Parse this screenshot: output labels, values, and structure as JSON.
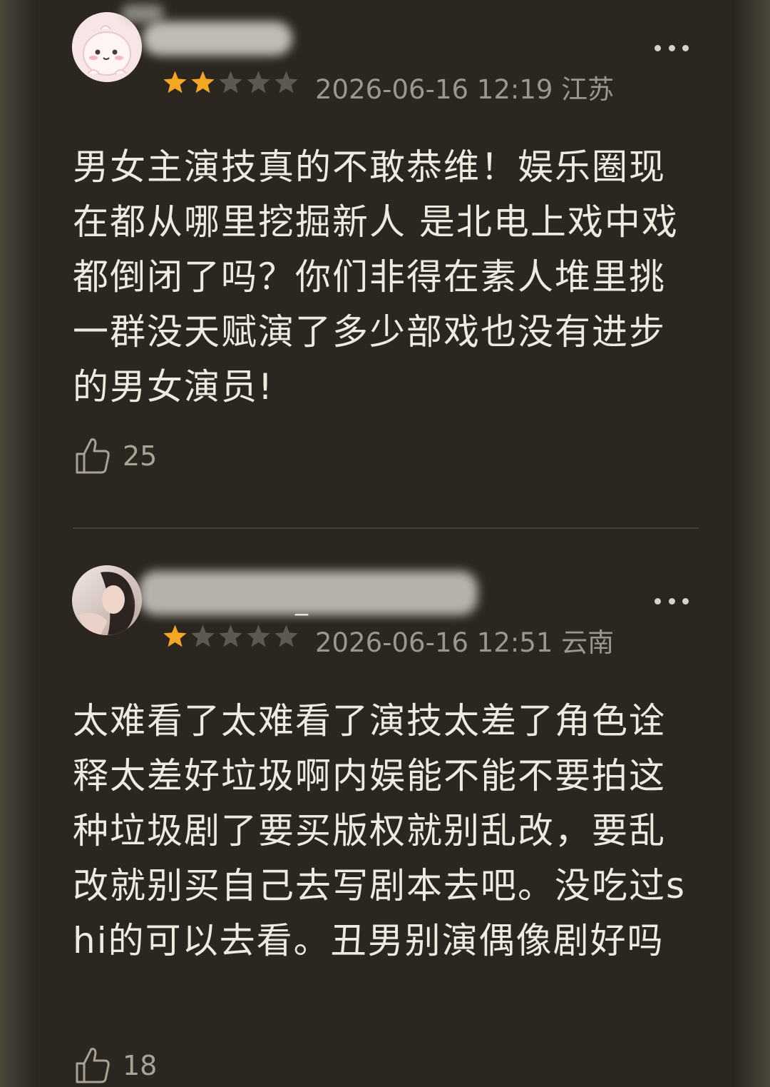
{
  "comments": [
    {
      "rating": 2,
      "max_rating": 5,
      "date": "2026-06-16 12:19 江苏",
      "text": "男女主演技真的不敢恭维！娱乐圈现在都从哪里挖掘新人 是北电上戏中戏都倒闭了吗？你们非得在素人堆里挑一群没天赋演了多少部戏也没有进步的男女演员!",
      "likes": "25",
      "avatar_icon": "cartoon-avatar-icon"
    },
    {
      "rating": 1,
      "max_rating": 5,
      "date": "2026-06-16 12:51 云南",
      "name_visible_fragment": "_",
      "text": "太难看了太难看了演技太差了角色诠释太差好垃圾啊内娱能不能不要拍这种垃圾剧了要买版权就别乱改，要乱改就别买自己去写剧本去吧。没吃过shi的可以去看。丑男别演偶像剧好吗",
      "likes": "18",
      "avatar_icon": "photo-avatar-icon"
    }
  ],
  "colors": {
    "background": "#2b2620",
    "text": "#efeae0",
    "meta": "#9c978d",
    "star_filled": "#f5a623",
    "star_empty": "#5e5950"
  }
}
